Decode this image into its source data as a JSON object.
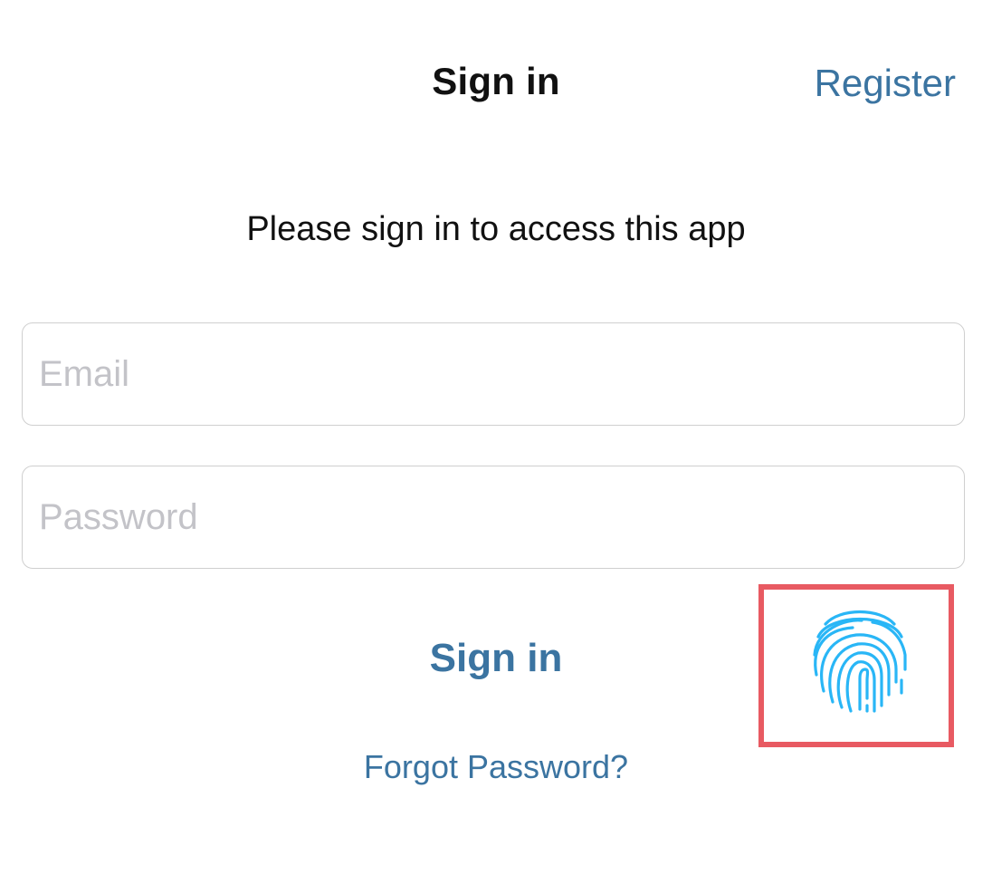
{
  "nav": {
    "title": "Sign in",
    "register_label": "Register"
  },
  "prompt": "Please sign in to access this app",
  "form": {
    "email_placeholder": "Email",
    "password_placeholder": "Password",
    "signin_label": "Sign in",
    "forgot_label": "Forgot Password?"
  },
  "biometric": {
    "icon": "fingerprint-icon",
    "highlighted": true
  },
  "colors": {
    "accent": "#3b74a1",
    "fingerprint": "#29b6f6",
    "highlight": "#e85a62",
    "placeholder": "#c3c3c8"
  }
}
